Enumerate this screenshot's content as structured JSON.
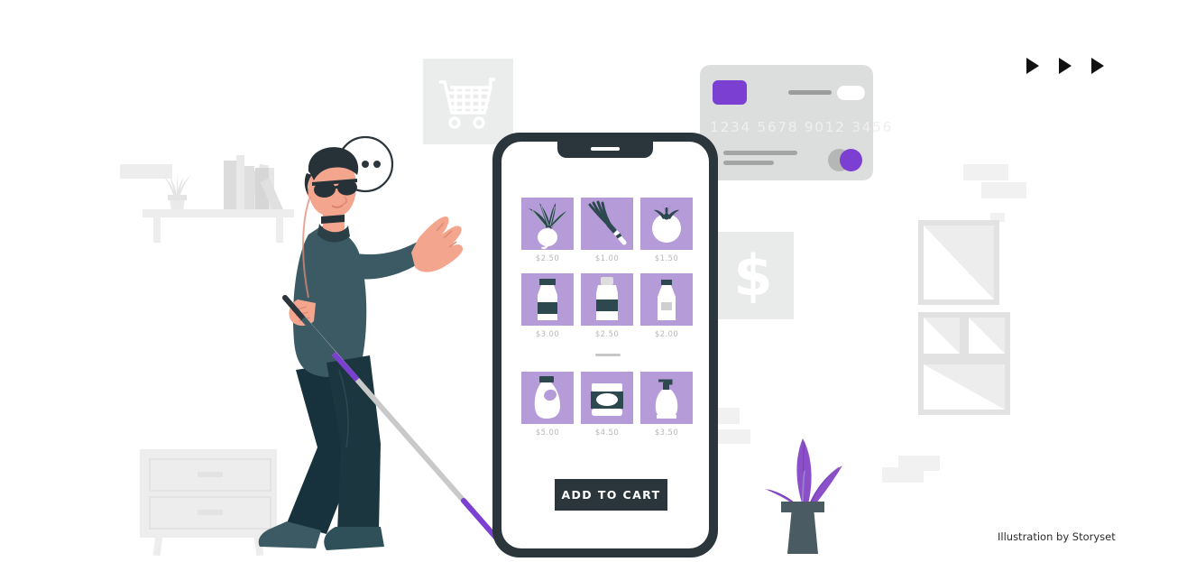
{
  "scene": {
    "title": "Blind person shopping online illustration",
    "background_color": "#ffffff",
    "credits": "Illustration by Storyset"
  },
  "palette": {
    "purple": "#7b3fd1",
    "tile_purple": "#b59bd8",
    "dark_slate": "#2b353c",
    "teal_shirt": "#3c5a63",
    "skin": "#f4a58e",
    "light_gray": "#ededed",
    "mid_gray": "#b8b8b8",
    "white": "#ffffff"
  },
  "phone": {
    "name": "smartphone-mockup",
    "notch_label": "speaker",
    "grid_rows": [
      {
        "row_name": "produce-row",
        "items": [
          {
            "icon": "turnip-icon",
            "price": "$2.50"
          },
          {
            "icon": "scallion-icon",
            "price": "$1.00"
          },
          {
            "icon": "tomato-icon",
            "price": "$1.50"
          }
        ]
      },
      {
        "row_name": "dairy-row",
        "items": [
          {
            "icon": "milk-bottle-icon",
            "price": "$3.00"
          },
          {
            "icon": "yogurt-jar-icon",
            "price": "$2.50"
          },
          {
            "icon": "milk-carton-icon",
            "price": "$2.00"
          }
        ]
      },
      {
        "row_name": "household-row",
        "items": [
          {
            "icon": "detergent-bottle-icon",
            "price": "$5.00"
          },
          {
            "icon": "cream-tub-icon",
            "price": "$4.50"
          },
          {
            "icon": "soap-dispenser-icon",
            "price": "$3.50"
          }
        ]
      }
    ],
    "add_to_cart_label": "ADD TO CART"
  },
  "credit_card": {
    "name": "credit-card-graphic",
    "number": "1234 5678 9012 3456",
    "chip_color": "#7b3fd1",
    "toggle_color": "#7b3fd1"
  },
  "dollar_panel": {
    "name": "dollar-sign-panel",
    "glyph": "$"
  },
  "cart_panel": {
    "name": "shopping-cart-panel",
    "icon": "shopping-cart-icon"
  },
  "arrows": {
    "name": "play-arrows",
    "count": 3,
    "glyph": "play-triangle-icon"
  },
  "character": {
    "name": "blind-shopper-character",
    "accessory": "white-cane",
    "eyewear": "sunglasses",
    "speech_bubble_dots": 3
  },
  "furniture": {
    "bookshelf": "wall-bookshelf",
    "nightstand": "two-drawer-nightstand",
    "plant": "potted-plant"
  },
  "frames": {
    "name": "picture-frames",
    "count": 4
  }
}
